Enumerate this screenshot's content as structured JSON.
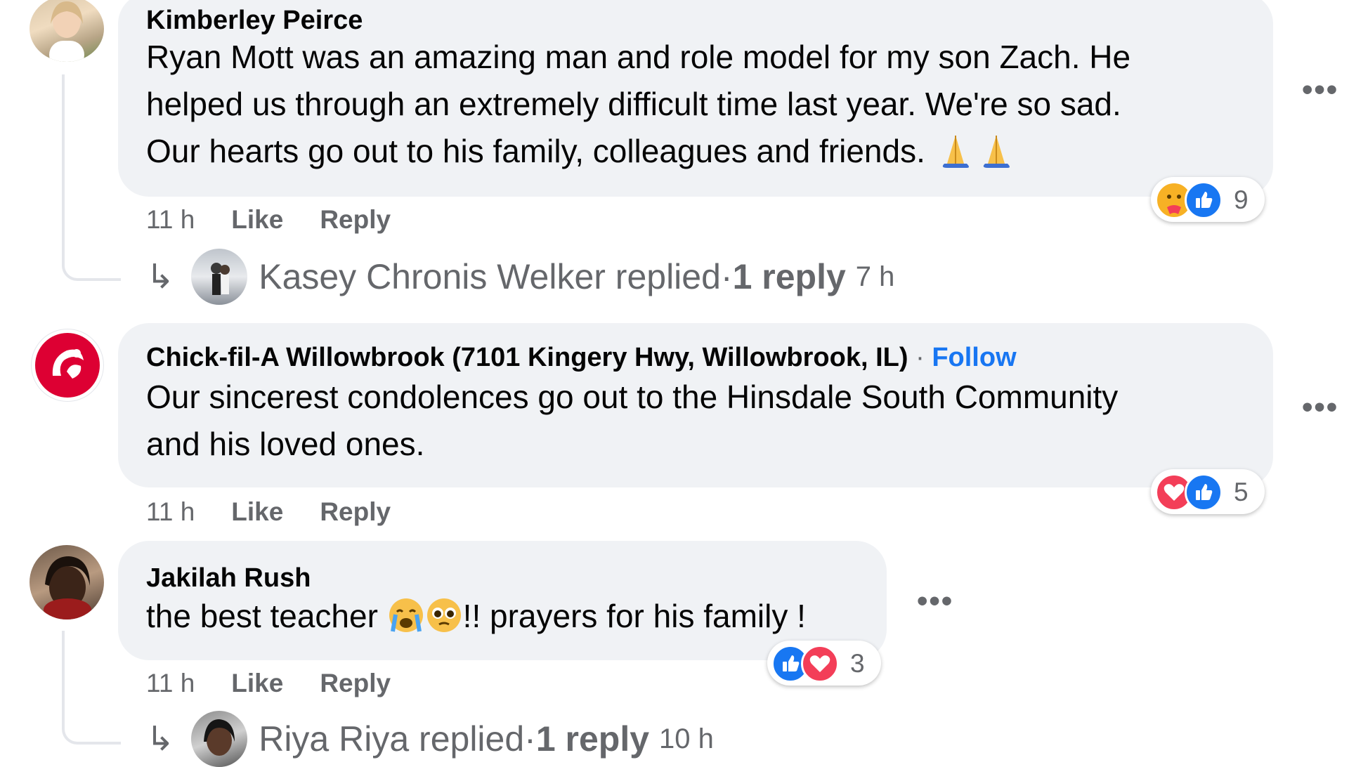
{
  "comments": [
    {
      "author": "Kimberley Peirce",
      "text_line1": "Ryan Mott was an amazing man and role model for my son Zach. He",
      "text_line2": "helped us through an extremely difficult time last year. We're so sad.",
      "text_line3": "Our hearts go out to his family, colleagues and friends.",
      "time": "11 h",
      "like_label": "Like",
      "reply_label": "Reply",
      "reactions": {
        "icons": [
          "care-icon",
          "like-icon"
        ],
        "count": "9"
      },
      "replies": {
        "replier": "Kasey Chronis Welker replied",
        "sep": " · ",
        "count_label": "1 reply",
        "time": "7 h"
      }
    },
    {
      "author": "Chick-fil-A Willowbrook (7101 Kingery Hwy, Willowbrook, IL)",
      "follow_sep": " · ",
      "follow_label": "Follow",
      "text_line1": "Our sincerest condolences go out to the Hinsdale South Community",
      "text_line2": "and his loved ones.",
      "time": "11 h",
      "like_label": "Like",
      "reply_label": "Reply",
      "reactions": {
        "icons": [
          "love-icon",
          "like-icon"
        ],
        "count": "5"
      }
    },
    {
      "author": "Jakilah Rush",
      "text_before": "the best teacher ",
      "text_after": "!! prayers for his family !",
      "time": "11 h",
      "like_label": "Like",
      "reply_label": "Reply",
      "reactions": {
        "icons": [
          "like-icon",
          "love-icon"
        ],
        "count": "3"
      },
      "replies": {
        "replier": "Riya Riya replied",
        "sep": " · ",
        "count_label": "1 reply",
        "time": "10 h"
      }
    }
  ],
  "colors": {
    "bubble": "#f0f2f5",
    "secondary_text": "#65676b",
    "link_blue": "#1876f2",
    "like_blue": "#1877f2",
    "love_red": "#f33e58"
  }
}
